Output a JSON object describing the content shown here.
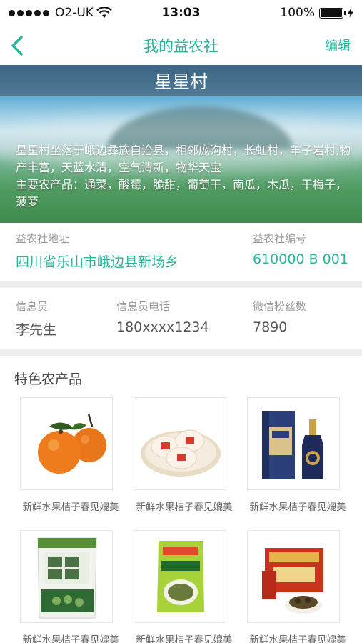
{
  "status_bar": {
    "carrier": "O2-UK",
    "time": "13:03",
    "battery": "100%",
    "signal_icon": "signal-dots-icon",
    "wifi_icon": "wifi-icon",
    "battery_icon": "battery-icon"
  },
  "nav": {
    "back_icon": "chevron-left-icon",
    "title": "我的益农社",
    "edit_label": "编辑",
    "accent_color": "#2ab59b"
  },
  "hero": {
    "village_name": "星星村",
    "description": "星星村坐落于峨边彝族自治县，相邻庞沟村，长虹村，羊子岩村,物产丰富，天蓝水清，空气清新，物华天宝",
    "products_line": "主要农产品：通菜，酸莓，脆甜，葡萄干，南瓜，木瓜，干梅子，菠萝"
  },
  "address_section": {
    "address_label": "益农社地址",
    "address_value": "四川省乐山市峨边县新场乡",
    "code_label": "益农社编号",
    "code_value": "610000 B 001"
  },
  "contact_section": {
    "officer_label": "信息员",
    "officer_value": "李先生",
    "phone_label": "信息员电话",
    "phone_value": "180xxxx1234",
    "fans_label": "微信粉丝数",
    "fans_value": "7890"
  },
  "products": {
    "title": "特色农产品",
    "items": [
      {
        "name": "新鲜水果桔子春见媲美",
        "image": "tangerines-image"
      },
      {
        "name": "新鲜水果桔子春见媲美",
        "image": "pastries-image"
      },
      {
        "name": "新鲜水果桔子春见媲美",
        "image": "liquor-bottle-image"
      },
      {
        "name": "新鲜水果桔子春见媲美",
        "image": "garlic-beans-bag-image"
      },
      {
        "name": "新鲜水果桔子春见媲美",
        "image": "sichuan-pickles-pack-image"
      },
      {
        "name": "新鲜水果桔子春见媲美",
        "image": "pickled-vegetables-box-image"
      }
    ]
  }
}
